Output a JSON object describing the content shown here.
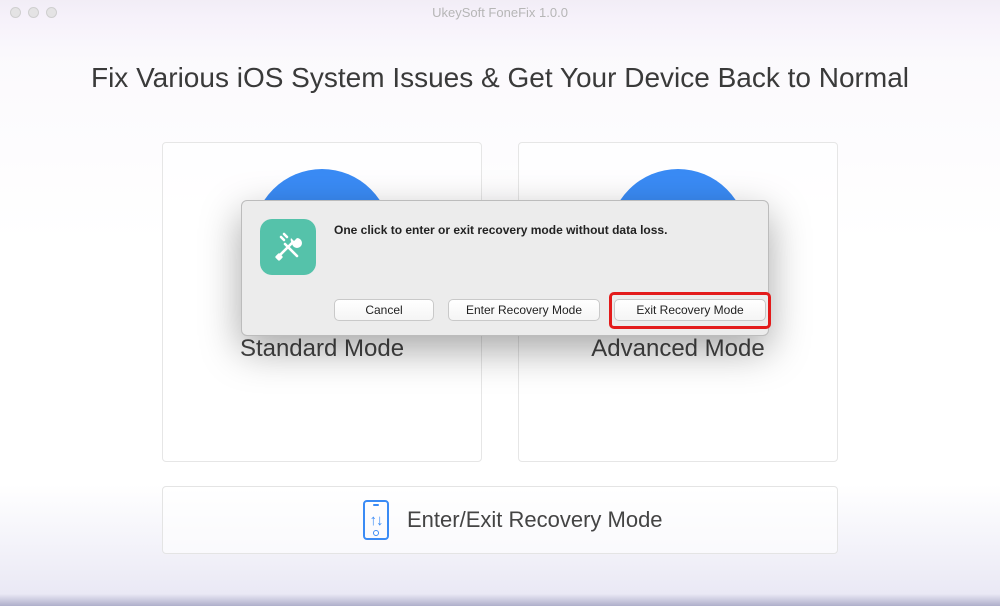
{
  "window": {
    "title": "UkeySoft FoneFix 1.0.0"
  },
  "main": {
    "headline": "Fix Various iOS System Issues & Get Your Device Back to Normal",
    "standard_mode_label": "Standard Mode",
    "advanced_mode_label": "Advanced Mode",
    "recovery_mode_label": "Enter/Exit Recovery Mode"
  },
  "dialog": {
    "message": "One click to enter or exit recovery mode without data loss.",
    "cancel_label": "Cancel",
    "enter_label": "Enter Recovery Mode",
    "exit_label": "Exit Recovery Mode"
  },
  "icons": {
    "tools_icon": "tools-icon",
    "phone_icon": "phone-recovery-icon"
  },
  "colors": {
    "accent_blue": "#3a8bf5",
    "icon_teal": "#55c2aa",
    "highlight_red": "#e31b1b"
  }
}
